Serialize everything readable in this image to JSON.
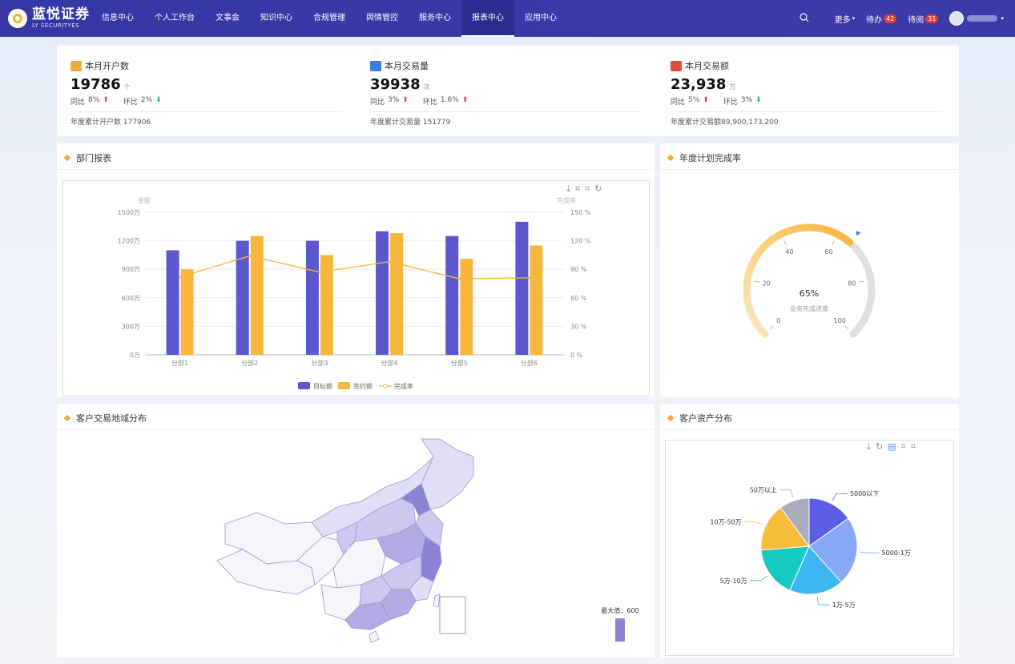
{
  "brand": {
    "name_cn": "蓝悦证券",
    "name_en": "LY SECURITYES"
  },
  "nav": [
    "信息中心",
    "个人工作台",
    "文事会",
    "知识中心",
    "合规管理",
    "舆情管控",
    "服务中心",
    "报表中心",
    "应用中心"
  ],
  "nav_active": "报表中心",
  "topbar": {
    "more": "更多",
    "todo_label": "待办",
    "todo_count": "42",
    "toread_label": "待阅",
    "toread_count": "31"
  },
  "stats": [
    {
      "title": "本月开户数",
      "value": "19786",
      "unit": "个",
      "yoy_label": "同比",
      "yoy": "8%",
      "yoy_dir": "up",
      "mom_label": "环比",
      "mom": "2%",
      "mom_dir": "down",
      "year_text": "年度累计开户数 177906",
      "icon_color": "#f5a83b"
    },
    {
      "title": "本月交易量",
      "value": "39938",
      "unit": "次",
      "yoy_label": "同比",
      "yoy": "3%",
      "yoy_dir": "up",
      "mom_label": "环比",
      "mom": "1.6%",
      "mom_dir": "up",
      "year_text": "年度累计交易量 151779",
      "icon_color": "#3a7de0"
    },
    {
      "title": "本月交易额",
      "value": "23,938",
      "unit": "万",
      "yoy_label": "同比",
      "yoy": "5%",
      "yoy_dir": "up",
      "mom_label": "环比",
      "mom": "3%",
      "mom_dir": "down",
      "year_text": "年度累计交易额89,900,173,200",
      "icon_color": "#e8483b"
    }
  ],
  "panels": {
    "dept": "部门报表",
    "plan": "年度计划完成率",
    "region": "客户交易地域分布",
    "asset": "客户资产分布"
  },
  "chart_data": [
    {
      "type": "bar",
      "categories": [
        "分部1",
        "分部2",
        "分部3",
        "分部4",
        "分部5",
        "分部6"
      ],
      "series": [
        {
          "name": "目标额",
          "type": "bar",
          "values": [
            1100,
            1200,
            1200,
            1300,
            1250,
            1400
          ]
        },
        {
          "name": "签约额",
          "type": "bar",
          "values": [
            900,
            1250,
            1050,
            1280,
            1010,
            1150
          ]
        },
        {
          "name": "完成率",
          "type": "line",
          "axis": "right",
          "values": [
            82,
            104,
            87,
            98,
            80,
            81
          ]
        }
      ],
      "ylabel": "金额",
      "ylabel_right": "完成率",
      "ylim": [
        0,
        1500
      ],
      "ylim_right": [
        0,
        150
      ],
      "yticks": [
        "0万",
        "300万",
        "600万",
        "900万",
        "1200万",
        "1500万"
      ],
      "yticks_right": [
        "0 %",
        "30 %",
        "60 %",
        "90 %",
        "120 %",
        "150 %"
      ],
      "legend": "bottom",
      "colors": {
        "目标额": "#5b57cc",
        "签约额": "#f8b63c",
        "完成率": "#f8b63c"
      }
    },
    {
      "type": "gauge",
      "value": 65,
      "value_text": "65%",
      "label": "业务完成进度",
      "range": [
        0,
        100
      ],
      "ticks": [
        "0",
        "20",
        "40",
        "60",
        "80",
        "100"
      ],
      "colors": {
        "progress_start": "#fde9c6",
        "progress_end": "#f8b63c",
        "track": "#e0e0e0"
      }
    },
    {
      "type": "pie",
      "slices": [
        {
          "label": "5000以下",
          "value": 15,
          "color": "#5c5ce6"
        },
        {
          "label": "5000-1万",
          "value": 23,
          "color": "#86a8f7"
        },
        {
          "label": "1万-5万",
          "value": 18,
          "color": "#3cb6f2"
        },
        {
          "label": "5万-10万",
          "value": 17,
          "color": "#16c9c2"
        },
        {
          "label": "10万-50万",
          "value": 16,
          "color": "#f8bd3b"
        },
        {
          "label": "50万以上",
          "value": 10,
          "color": "#a9aebc"
        }
      ]
    }
  ],
  "map": {
    "legend_max": "最大值：600",
    "fill_colors": [
      "#f6f5fc",
      "#e1dff6",
      "#cdc8ef",
      "#b3abe6",
      "#8c83d6"
    ]
  }
}
